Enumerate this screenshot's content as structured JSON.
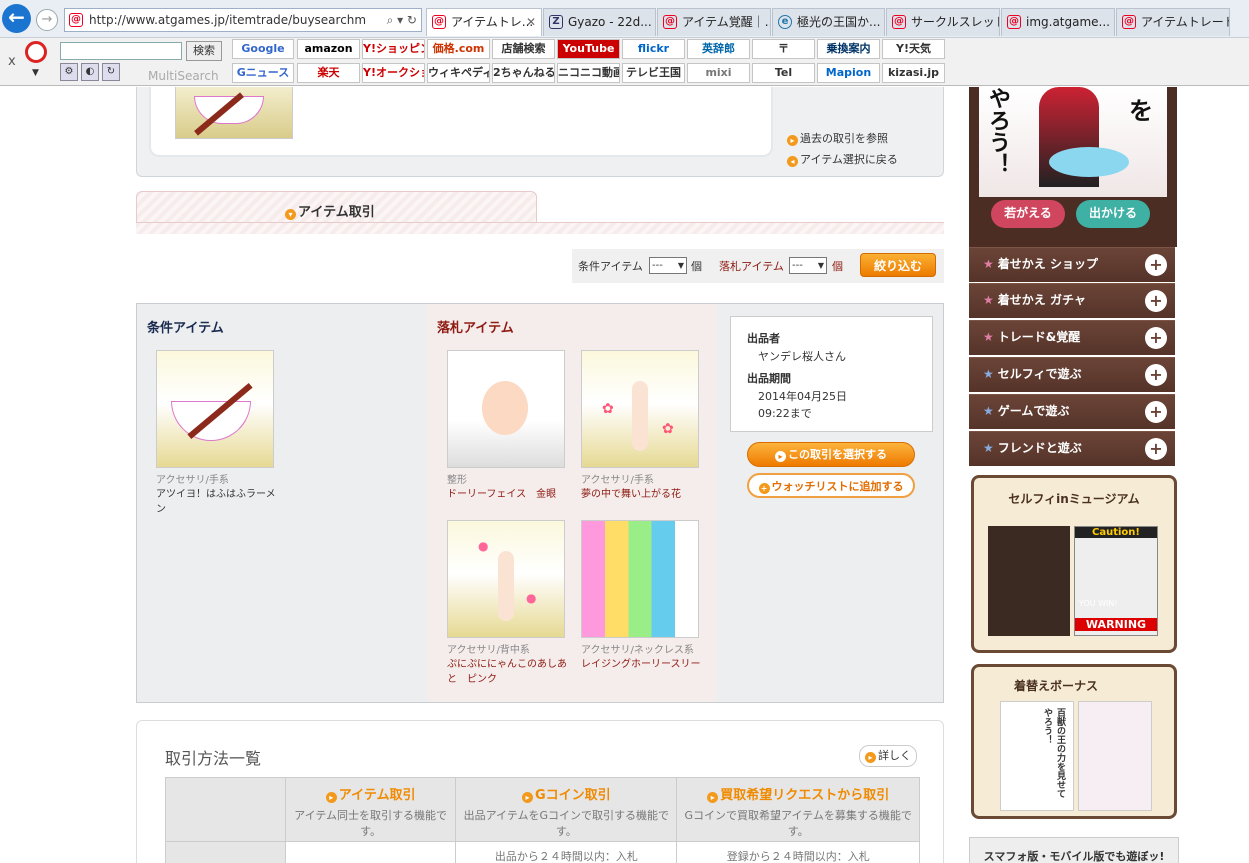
{
  "browser": {
    "url": "http://www.atgames.jp/itemtrade/buysearchm",
    "tabs": [
      {
        "label": "アイテムトレ...",
        "active": true
      },
      {
        "label": "Gyazo - 22d..."
      },
      {
        "label": "アイテム覚醒｜..."
      },
      {
        "label": "極光の王国か..."
      },
      {
        "label": "サークルスレッド..."
      },
      {
        "label": "img.atgame..."
      },
      {
        "label": "アイテムトレード..."
      }
    ]
  },
  "multisearch": {
    "search_button": "検索",
    "label": "MultiSearch",
    "close": "x"
  },
  "quick_links": {
    "row1": [
      "Google",
      "amazon",
      "Y!ショッピング",
      "価格.com",
      "店舗検索",
      "YouTube",
      "flickr",
      "英辞郎",
      "〒",
      "乗換案内",
      "Y!天気"
    ],
    "row2": [
      "Gニュース",
      "楽天",
      "Y!オークション",
      "ウィキペディア",
      "2ちゃんねる",
      "ニコニコ動画",
      "テレビ王国",
      "mixi",
      "Tel",
      "Mapion",
      "kizasi.jp"
    ]
  },
  "top": {
    "link_history": "過去の取引を参照",
    "link_back": "アイテム選択に戻る"
  },
  "section_tab": "アイテム取引",
  "filter": {
    "cond_label": "条件アイテム",
    "drop_label": "落札アイテム",
    "sel_value": "---",
    "unit": "個",
    "button": "絞り込む"
  },
  "cond": {
    "heading": "条件アイテム",
    "items": [
      {
        "category": "アクセサリ/手系",
        "name": "アツイヨ！はふはふラーメン"
      }
    ]
  },
  "drop": {
    "heading": "落札アイテム",
    "items": [
      {
        "category": "整形",
        "name": "ドーリーフェイス　金眼"
      },
      {
        "category": "アクセサリ/手系",
        "name": "夢の中で舞い上がる花"
      },
      {
        "category": "アクセサリ/背中系",
        "name": "ぷにぷににゃんこのあしあと　ピンク"
      },
      {
        "category": "アクセサリ/ネックレス系",
        "name": "レイジングホーリースリー"
      }
    ]
  },
  "seller": {
    "seller_label": "出品者",
    "seller_name": "ヤンデレ桜人さん",
    "period_label": "出品期間",
    "date": "2014年04月25日",
    "time": "09:22まで"
  },
  "actions": {
    "select": "この取引を選択する",
    "watch": "ウォッチリストに追加する"
  },
  "methods": {
    "title": "取引方法一覧",
    "detail": "詳しく",
    "cols": [
      {
        "head": "アイテム取引",
        "desc": "アイテム同士を取引する機能です。"
      },
      {
        "head": "Gコイン取引",
        "desc": "出品アイテムをGコインで取引する機能です。",
        "row2": "出品から２４時間以内：入札"
      },
      {
        "head": "買取希望リクエストから取引",
        "desc": "Gコインで買取希望アイテムを募集する機能です。",
        "row2": "登録から２４時間以内：入札"
      }
    ]
  },
  "sidebar": {
    "banner_text": "やろう！",
    "banner_char": "を",
    "btn_left": "若がえる",
    "btn_right": "出かける",
    "menu": [
      "着せかえ ショップ",
      "着せかえ ガチャ",
      "トレード&覚醒",
      "セルフィで遊ぶ",
      "ゲームで遊ぶ",
      "フレンドと遊ぶ"
    ],
    "museum_title": "セルフィinミュージアム",
    "museum_caution": "Caution!",
    "museum_warning": "WARNING",
    "museum_youwin": "YOU WIN!",
    "bonus_title": "着替えボーナス",
    "bonus_text": "百獣の王の力を見せてやろう！",
    "smartphone": "スマフォ版・モバイル版でも遊ぼッ!"
  }
}
